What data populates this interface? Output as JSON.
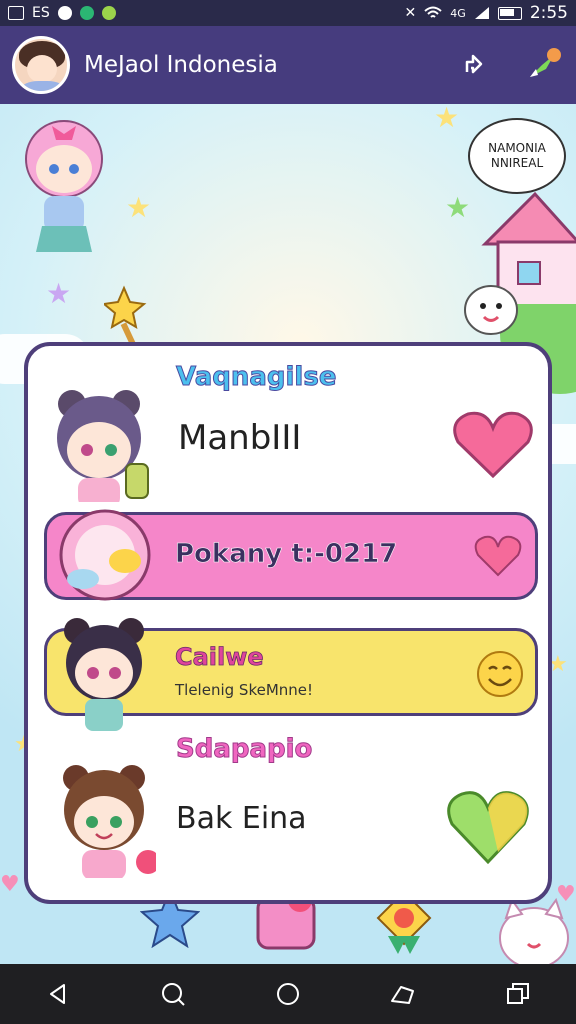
{
  "status_bar": {
    "left_icons": [
      "notification-icon",
      "sim-icon",
      "shield-icon",
      "app-icon",
      "app-icon-2"
    ],
    "left_text": "ES",
    "signal_text": "4G",
    "time": "2:55"
  },
  "app_bar": {
    "title": "MeJaol Indonesia",
    "actions": [
      "share-icon",
      "rocket-icon"
    ]
  },
  "speech_bubble": {
    "line1": "NAMONIA",
    "line2": "NNIREAL"
  },
  "card": {
    "section1_heading": "Vaqnagilse",
    "section1_name": "ManbIII",
    "pink_row_label": "Pokany t:-0217",
    "yellow_row_title": "Cailwe",
    "yellow_row_subtitle": "Tlelenig SkeMnne!",
    "section3_heading": "Sdapapio",
    "section3_name": "Bak Eina"
  },
  "colors": {
    "appbar": "#463c7e",
    "pink_row": "#f586c9",
    "yellow_row": "#f8e46c",
    "card_border": "#4e3f7a"
  },
  "nav": [
    "back-icon",
    "search-icon",
    "home-icon",
    "share-icon",
    "recents-icon"
  ]
}
